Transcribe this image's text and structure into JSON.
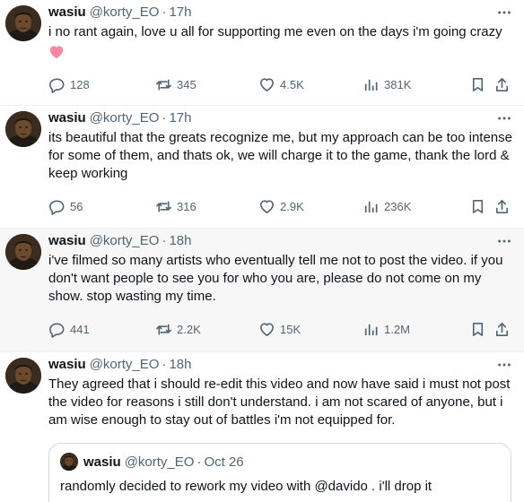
{
  "tweets": [
    {
      "name": "wasiu",
      "handle": "@korty_EO",
      "dot": "·",
      "time": "17h",
      "text": "i no rant again, love u all for supporting me even on the days i'm going crazy",
      "emoji": "pink-heart",
      "replies": "128",
      "retweets": "345",
      "likes": "4.5K",
      "views": "381K"
    },
    {
      "name": "wasiu",
      "handle": "@korty_EO",
      "dot": "·",
      "time": "17h",
      "text": "its beautiful that the greats recognize me, but my approach can be too intense for some of them, and thats ok, we will charge it to the game, thank the lord & keep working",
      "replies": "56",
      "retweets": "316",
      "likes": "2.9K",
      "views": "236K"
    },
    {
      "name": "wasiu",
      "handle": "@korty_EO",
      "dot": "·",
      "time": "18h",
      "text": "i've filmed so many artists who eventually tell me not to post the video. if you don't want people to see you for who you are, please do not come on my show. stop wasting my time.",
      "replies": "441",
      "retweets": "2.2K",
      "likes": "15K",
      "views": "1.2M"
    },
    {
      "name": "wasiu",
      "handle": "@korty_EO",
      "dot": "·",
      "time": "18h",
      "text": "They agreed that i should re-edit this video and now have said i must not post the video for reasons i still don't understand. i am not scared of anyone, but i am wise enough to stay out of battles i'm not equipped for.",
      "quote": {
        "name": "wasiu",
        "handle": "@korty_EO",
        "dot": "·",
        "time": "Oct 26",
        "text": "randomly decided to rework my video with @davido . i'll drop it"
      }
    }
  ],
  "colors": {
    "text_primary": "#0f1419",
    "text_secondary": "#536471",
    "heart_emoji": "#f4889e",
    "hover_row": "#f7f7f7"
  },
  "icons": [
    "more-icon",
    "reply-icon",
    "retweet-icon",
    "like-icon",
    "views-icon",
    "bookmark-icon",
    "share-icon"
  ]
}
